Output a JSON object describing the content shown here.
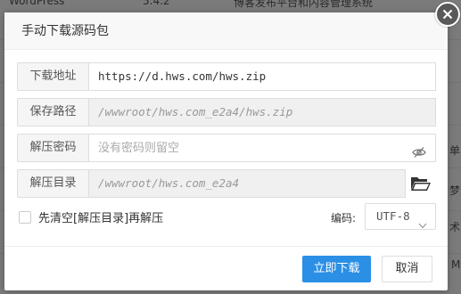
{
  "background": {
    "row1": {
      "name": "WordPress",
      "version": "5.4.2",
      "desc": "博客发布平台和内容管理系统"
    },
    "side_fragments": [
      "单",
      "梦",
      "术",
      "M"
    ]
  },
  "dialog": {
    "title": "手动下载源码包",
    "fields": [
      {
        "label": "下载地址",
        "value": "https://d.hws.com/hws.zip",
        "placeholder": ""
      },
      {
        "label": "保存路径",
        "value": "/wwwroot/hws.com_e2a4/hws.zip",
        "placeholder": ""
      },
      {
        "label": "解压密码",
        "value": "",
        "placeholder": "没有密码则留空"
      },
      {
        "label": "解压目录",
        "value": "/wwwroot/hws.com_e2a4",
        "placeholder": ""
      }
    ],
    "checkbox_label": "先清空[解压目录]再解压",
    "encoding_label": "编码:",
    "encoding_value": "UTF-8",
    "confirm_label": "立即下载",
    "cancel_label": "取消"
  },
  "colors": {
    "primary": "#2b8fe6",
    "close_bg": "#595959"
  },
  "icons": [
    "close-icon",
    "eye-slash-icon",
    "folder-open-icon",
    "chevron-down-icon"
  ]
}
